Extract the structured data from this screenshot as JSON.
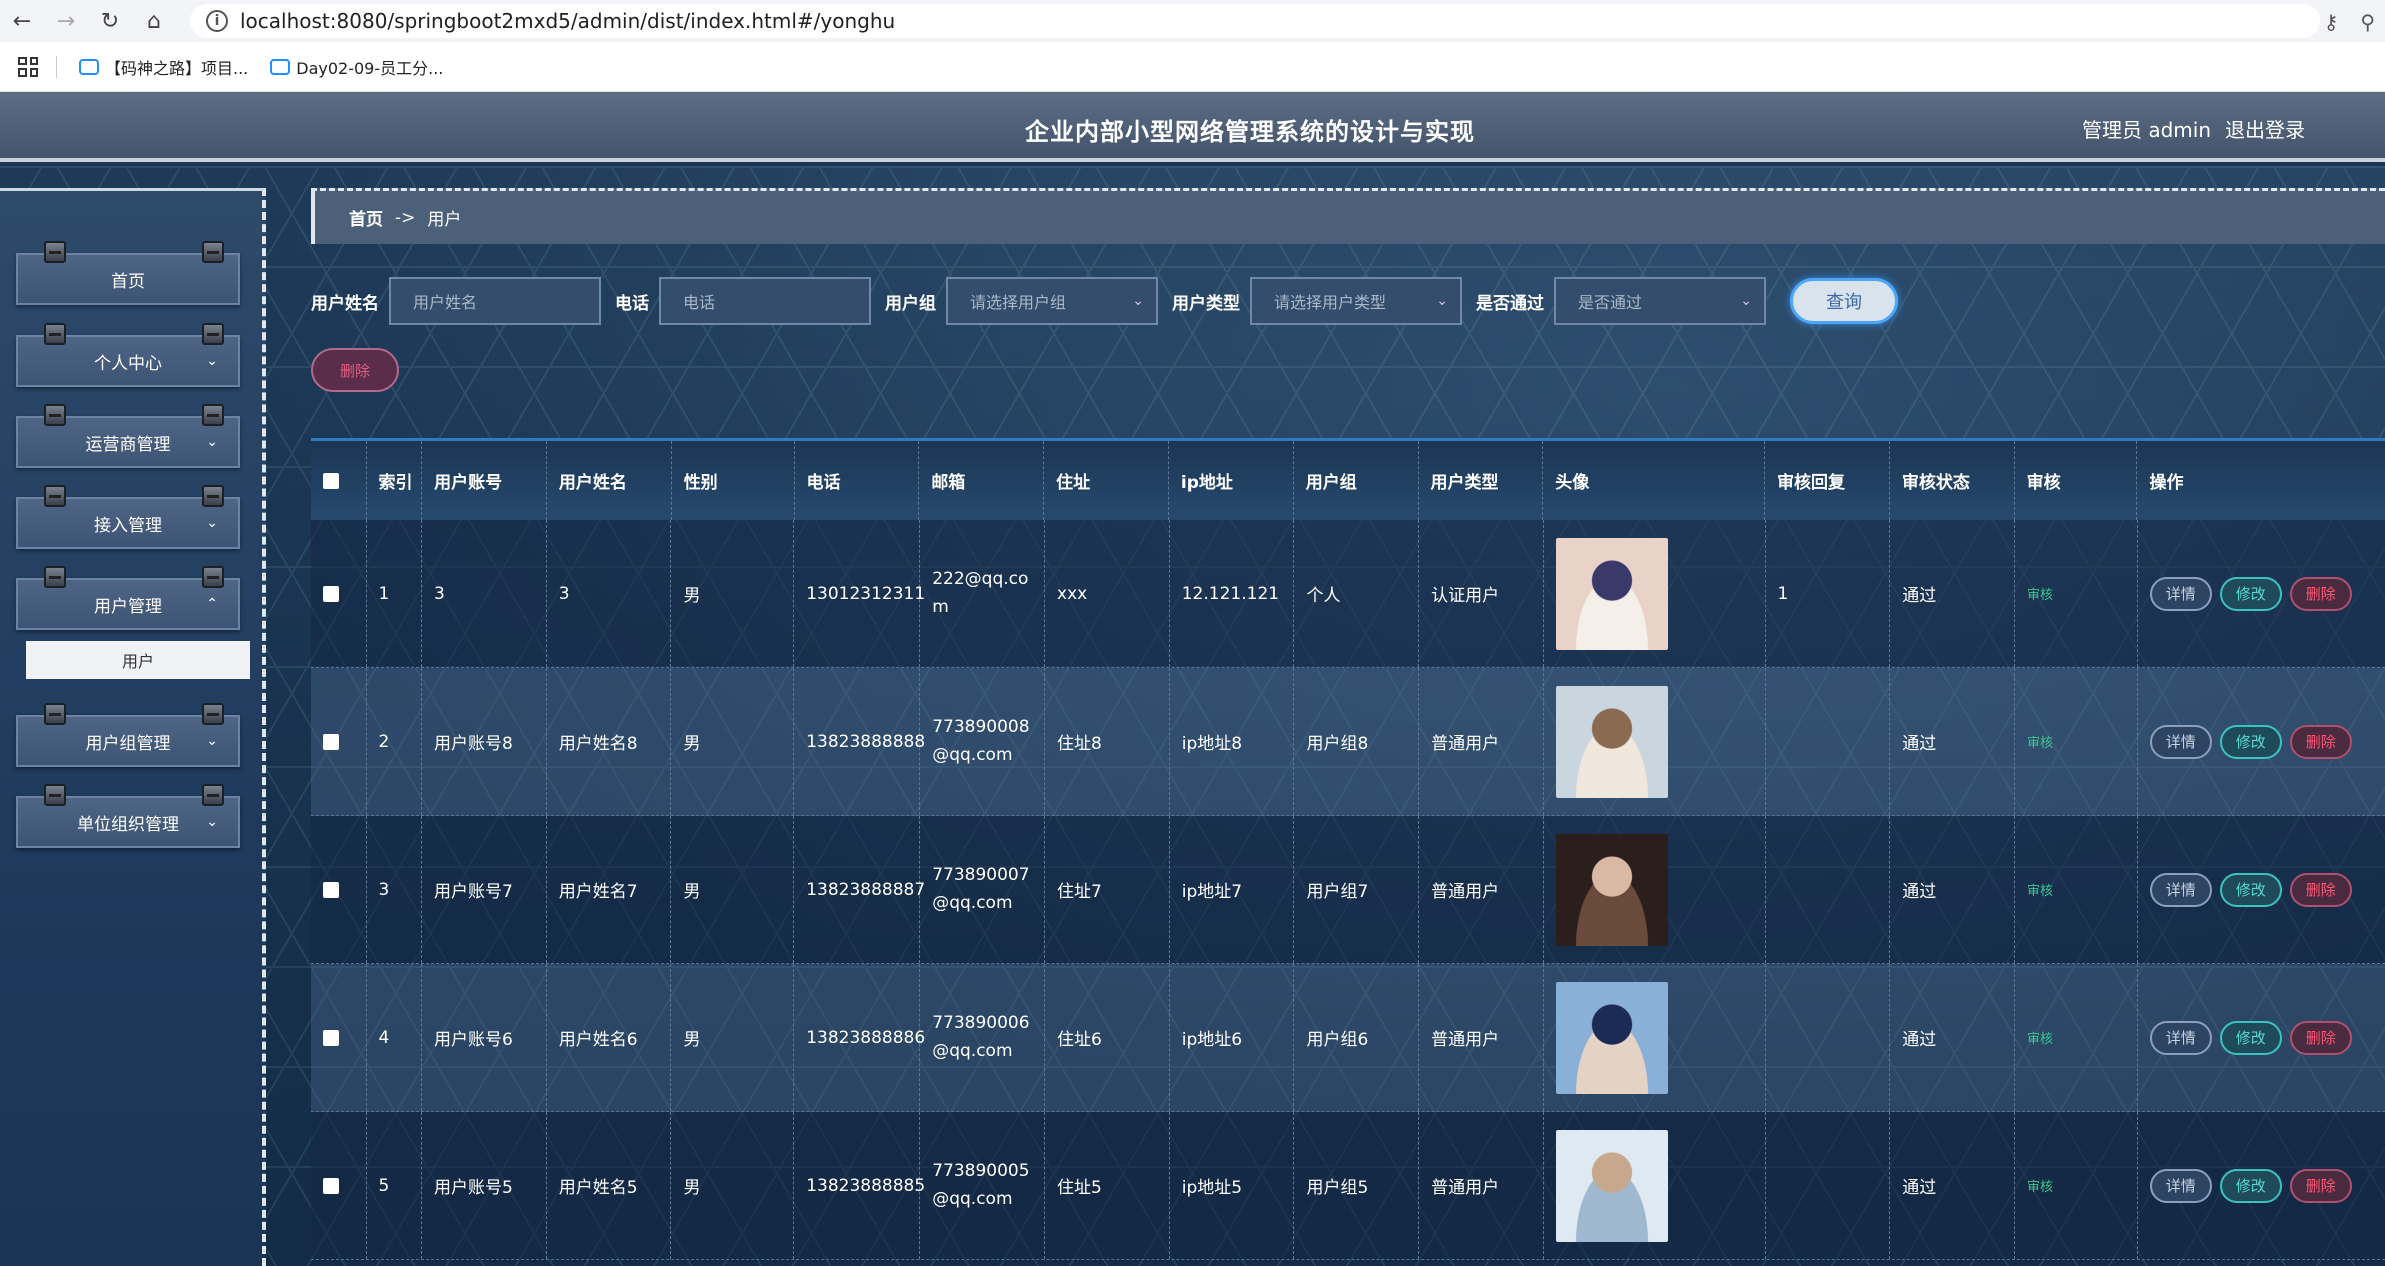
{
  "browser": {
    "url": "localhost:8080/springboot2mxd5/admin/dist/index.html#/yonghu",
    "bookmarks": [
      "【码神之路】项目...",
      "Day02-09-员工分..."
    ]
  },
  "header": {
    "title": "企业内部小型网络管理系统的设计与实现",
    "user_label": "管理员 admin",
    "logout": "退出登录"
  },
  "sidebar": {
    "items": [
      {
        "label": "首页",
        "expandable": false
      },
      {
        "label": "个人中心",
        "expandable": true
      },
      {
        "label": "运营商管理",
        "expandable": true
      },
      {
        "label": "接入管理",
        "expandable": true
      },
      {
        "label": "用户管理",
        "expandable": true,
        "expanded": true
      },
      {
        "label": "用户组管理",
        "expandable": true
      },
      {
        "label": "单位组织管理",
        "expandable": true
      }
    ],
    "active_sub": "用户"
  },
  "breadcrumb": {
    "home": "首页",
    "sep": "->",
    "current": "用户"
  },
  "search": {
    "name_label": "用户姓名",
    "name_placeholder": "用户姓名",
    "phone_label": "电话",
    "phone_placeholder": "电话",
    "group_label": "用户组",
    "group_placeholder": "请选择用户组",
    "type_label": "用户类型",
    "type_placeholder": "请选择用户类型",
    "pass_label": "是否通过",
    "pass_placeholder": "是否通过",
    "query": "查询"
  },
  "batch_delete": "删除",
  "table": {
    "headers": [
      "索引",
      "用户账号",
      "用户姓名",
      "性别",
      "电话",
      "邮箱",
      "住址",
      "ip地址",
      "用户组",
      "用户类型",
      "头像",
      "审核回复",
      "审核状态",
      "审核",
      "操作"
    ],
    "rows": [
      {
        "idx": "1",
        "account": "3",
        "name": "3",
        "gender": "男",
        "phone": "13012312311",
        "email": "222@qq.com",
        "address": "xxx",
        "ip": "12.121.121",
        "group": "个人",
        "type": "认证用户",
        "reply": "1",
        "status": "通过",
        "audit": "审核"
      },
      {
        "idx": "2",
        "account": "用户账号8",
        "name": "用户姓名8",
        "gender": "男",
        "phone": "13823888888",
        "email": "773890008@qq.com",
        "address": "住址8",
        "ip": "ip地址8",
        "group": "用户组8",
        "type": "普通用户",
        "reply": "",
        "status": "通过",
        "audit": "审核"
      },
      {
        "idx": "3",
        "account": "用户账号7",
        "name": "用户姓名7",
        "gender": "男",
        "phone": "13823888887",
        "email": "773890007@qq.com",
        "address": "住址7",
        "ip": "ip地址7",
        "group": "用户组7",
        "type": "普通用户",
        "reply": "",
        "status": "通过",
        "audit": "审核"
      },
      {
        "idx": "4",
        "account": "用户账号6",
        "name": "用户姓名6",
        "gender": "男",
        "phone": "13823888886",
        "email": "773890006@qq.com",
        "address": "住址6",
        "ip": "ip地址6",
        "group": "用户组6",
        "type": "普通用户",
        "reply": "",
        "status": "通过",
        "audit": "审核"
      },
      {
        "idx": "5",
        "account": "用户账号5",
        "name": "用户姓名5",
        "gender": "男",
        "phone": "13823888885",
        "email": "773890005@qq.com",
        "address": "住址5",
        "ip": "ip地址5",
        "group": "用户组5",
        "type": "普通用户",
        "reply": "",
        "status": "通过",
        "audit": "审核"
      }
    ],
    "ops": {
      "detail": "详情",
      "edit": "修改",
      "delete": "删除"
    }
  },
  "colors": {
    "accent": "#4aa6ff",
    "audit": "#37c88a",
    "danger": "#ff5577",
    "edit": "#3cc3c0"
  }
}
